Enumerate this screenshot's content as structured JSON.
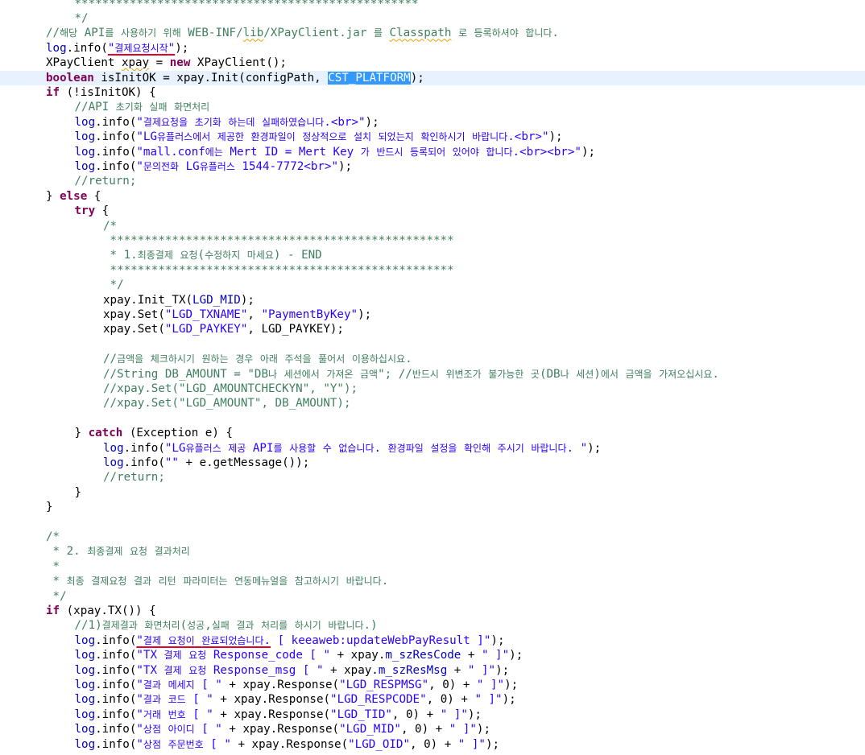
{
  "code_lines": [
    {
      "indent": 1,
      "tokens": [
        {
          "t": "**************************************************",
          "c": "cm"
        }
      ]
    },
    {
      "indent": 1,
      "tokens": [
        {
          "t": "*/",
          "c": "cm"
        }
      ]
    },
    {
      "indent": 0,
      "tokens": [
        {
          "t": "//해당 API를 사용하기 위해 WEB-INF/",
          "c": "cm"
        },
        {
          "t": "lib",
          "c": "cm",
          "sq": true
        },
        {
          "t": "/XPayClient.jar 를 ",
          "c": "cm"
        },
        {
          "t": "Classpath",
          "c": "cm",
          "sq": true
        },
        {
          "t": " 로 등록하셔야 합니다.",
          "c": "cm"
        }
      ]
    },
    {
      "indent": 0,
      "tokens": [
        {
          "t": "log",
          "c": "fld"
        },
        {
          "t": ".info("
        },
        {
          "t": "\"결제요청시작\"",
          "c": "str",
          "ul": true
        },
        {
          "t": ");"
        }
      ]
    },
    {
      "indent": 0,
      "tokens": [
        {
          "t": "XPayClient "
        },
        {
          "t": "xpay",
          "sq": true
        },
        {
          "t": " = "
        },
        {
          "t": "new",
          "c": "kw"
        },
        {
          "t": " XPayClient();"
        }
      ]
    },
    {
      "indent": 0,
      "current": true,
      "tokens": [
        {
          "t": "boolean",
          "c": "kw"
        },
        {
          "t": " isInitOK = xpay.Init(configPath, "
        },
        {
          "t": "CST_PLATFORM",
          "sel": true
        },
        {
          "t": ");"
        }
      ]
    },
    {
      "indent": 0,
      "tokens": [
        {
          "t": "if",
          "c": "kw"
        },
        {
          "t": " (!isInitOK) {"
        }
      ]
    },
    {
      "indent": 1,
      "tokens": [
        {
          "t": "//API 초기화 실패 화면처리",
          "c": "cm"
        }
      ]
    },
    {
      "indent": 1,
      "tokens": [
        {
          "t": "log",
          "c": "fld"
        },
        {
          "t": ".info("
        },
        {
          "t": "\"결제요청을 초기화 하는데 실패하였습니다.<br>\"",
          "c": "str"
        },
        {
          "t": ");"
        }
      ]
    },
    {
      "indent": 1,
      "tokens": [
        {
          "t": "log",
          "c": "fld"
        },
        {
          "t": ".info("
        },
        {
          "t": "\"LG유플러스에서 제공한 환경파일이 정상적으로 설치 되었는지 확인하시기 바랍니다.<br>\"",
          "c": "str"
        },
        {
          "t": ");"
        }
      ]
    },
    {
      "indent": 1,
      "tokens": [
        {
          "t": "log",
          "c": "fld"
        },
        {
          "t": ".info("
        },
        {
          "t": "\"mall.conf에는 Mert ID = Mert Key 가 반드시 등록되어 있어야 합니다.<br><br>\"",
          "c": "str"
        },
        {
          "t": ");"
        }
      ]
    },
    {
      "indent": 1,
      "tokens": [
        {
          "t": "log",
          "c": "fld"
        },
        {
          "t": ".info("
        },
        {
          "t": "\"문의전화 LG유플러스 1544-7772<br>\"",
          "c": "str"
        },
        {
          "t": ");"
        }
      ]
    },
    {
      "indent": 1,
      "tokens": [
        {
          "t": "//return;",
          "c": "cm"
        }
      ]
    },
    {
      "indent": 0,
      "tokens": [
        {
          "t": "} "
        },
        {
          "t": "else",
          "c": "kw"
        },
        {
          "t": " {"
        }
      ]
    },
    {
      "indent": 1,
      "tokens": [
        {
          "t": "try",
          "c": "kw"
        },
        {
          "t": " {"
        }
      ]
    },
    {
      "indent": 2,
      "tokens": [
        {
          "t": "/*",
          "c": "cm"
        }
      ]
    },
    {
      "indent": 2,
      "tokens": [
        {
          "t": " **************************************************",
          "c": "cm"
        }
      ]
    },
    {
      "indent": 2,
      "tokens": [
        {
          "t": " * 1.최종결제 요청(수정하지 마세요) - END",
          "c": "cm"
        }
      ]
    },
    {
      "indent": 2,
      "tokens": [
        {
          "t": " **************************************************",
          "c": "cm"
        }
      ]
    },
    {
      "indent": 2,
      "tokens": [
        {
          "t": " */",
          "c": "cm"
        }
      ]
    },
    {
      "indent": 2,
      "tokens": [
        {
          "t": "xpay.Init_TX("
        },
        {
          "t": "LGD_MID",
          "c": "fld"
        },
        {
          "t": ");"
        }
      ]
    },
    {
      "indent": 2,
      "tokens": [
        {
          "t": "xpay.Set("
        },
        {
          "t": "\"LGD_TXNAME\"",
          "c": "str"
        },
        {
          "t": ", "
        },
        {
          "t": "\"PaymentByKey\"",
          "c": "str"
        },
        {
          "t": ");"
        }
      ]
    },
    {
      "indent": 2,
      "tokens": [
        {
          "t": "xpay.Set("
        },
        {
          "t": "\"LGD_PAYKEY\"",
          "c": "str"
        },
        {
          "t": ", LGD_PAYKEY);"
        }
      ]
    },
    {
      "indent": 0,
      "tokens": []
    },
    {
      "indent": 2,
      "tokens": [
        {
          "t": "//금액을 체크하시기 원하는 경우 아래 주석을 풀어서 이용하십시요.",
          "c": "cm"
        }
      ]
    },
    {
      "indent": 2,
      "tokens": [
        {
          "t": "//String DB_AMOUNT = \"DB나 세션에서 가져온 금액\"; //반드시 위변조가 불가능한 곳(DB나 세션)에서 금액을 가져오십시요.",
          "c": "cm"
        }
      ]
    },
    {
      "indent": 2,
      "tokens": [
        {
          "t": "//xpay.Set(\"LGD_AMOUNTCHECKYN\", \"Y\");",
          "c": "cm"
        }
      ]
    },
    {
      "indent": 2,
      "tokens": [
        {
          "t": "//xpay.Set(\"LGD_AMOUNT\", DB_AMOUNT);",
          "c": "cm"
        }
      ]
    },
    {
      "indent": 0,
      "tokens": []
    },
    {
      "indent": 1,
      "tokens": [
        {
          "t": "} "
        },
        {
          "t": "catch",
          "c": "kw"
        },
        {
          "t": " (Exception e) {"
        }
      ]
    },
    {
      "indent": 2,
      "tokens": [
        {
          "t": "log",
          "c": "fld"
        },
        {
          "t": ".info("
        },
        {
          "t": "\"LG유플러스 제공 API를 사용할 수 없습니다. 환경파일 설정을 확인해 주시기 바랍니다. \"",
          "c": "str"
        },
        {
          "t": ");"
        }
      ]
    },
    {
      "indent": 2,
      "tokens": [
        {
          "t": "log",
          "c": "fld"
        },
        {
          "t": ".info("
        },
        {
          "t": "\"\"",
          "c": "str"
        },
        {
          "t": " + e.getMessage());"
        }
      ]
    },
    {
      "indent": 2,
      "tokens": [
        {
          "t": "//return;",
          "c": "cm"
        }
      ]
    },
    {
      "indent": 1,
      "tokens": [
        {
          "t": "}"
        }
      ]
    },
    {
      "indent": 0,
      "tokens": [
        {
          "t": "}"
        }
      ]
    },
    {
      "indent": 0,
      "tokens": []
    },
    {
      "indent": 0,
      "tokens": [
        {
          "t": "/*",
          "c": "cm"
        }
      ]
    },
    {
      "indent": 0,
      "tokens": [
        {
          "t": " * 2. 최종결제 요청 결과처리",
          "c": "cm"
        }
      ]
    },
    {
      "indent": 0,
      "tokens": [
        {
          "t": " *",
          "c": "cm"
        }
      ]
    },
    {
      "indent": 0,
      "tokens": [
        {
          "t": " * 최종 결제요청 결과 리턴 파라미터는 연동메뉴얼을 참고하시기 바랍니다.",
          "c": "cm"
        }
      ]
    },
    {
      "indent": 0,
      "tokens": [
        {
          "t": " */",
          "c": "cm"
        }
      ]
    },
    {
      "indent": 0,
      "tokens": [
        {
          "t": "if",
          "c": "kw"
        },
        {
          "t": " (xpay.TX()) {"
        }
      ]
    },
    {
      "indent": 1,
      "tokens": [
        {
          "t": "//1)결제결과 화면처리(성공,실패 결과 처리를 하시기 바랍니다.)",
          "c": "cm"
        }
      ]
    },
    {
      "indent": 1,
      "tokens": [
        {
          "t": "log",
          "c": "fld"
        },
        {
          "t": ".info("
        },
        {
          "t": "\"결제 요청이 완료되었습니다.",
          "c": "str",
          "ul": true
        },
        {
          "t": " [ keeaweb:updateWebPayResult ]\"",
          "c": "str"
        },
        {
          "t": ");"
        }
      ]
    },
    {
      "indent": 1,
      "tokens": [
        {
          "t": "log",
          "c": "fld"
        },
        {
          "t": ".info("
        },
        {
          "t": "\"TX 결제 요청 Response_code [ \"",
          "c": "str"
        },
        {
          "t": " + xpay."
        },
        {
          "t": "m_szResCode",
          "c": "fld"
        },
        {
          "t": " + "
        },
        {
          "t": "\" ]\"",
          "c": "str"
        },
        {
          "t": ");"
        }
      ]
    },
    {
      "indent": 1,
      "tokens": [
        {
          "t": "log",
          "c": "fld"
        },
        {
          "t": ".info("
        },
        {
          "t": "\"TX 결제 요청 Response_msg [ \"",
          "c": "str"
        },
        {
          "t": " + xpay."
        },
        {
          "t": "m_szResMsg",
          "c": "fld"
        },
        {
          "t": " + "
        },
        {
          "t": "\" ]\"",
          "c": "str"
        },
        {
          "t": ");"
        }
      ]
    },
    {
      "indent": 1,
      "tokens": [
        {
          "t": "log",
          "c": "fld"
        },
        {
          "t": ".info("
        },
        {
          "t": "\"결과 메세지 [ \"",
          "c": "str"
        },
        {
          "t": " + xpay.Response("
        },
        {
          "t": "\"LGD_RESPMSG\"",
          "c": "str"
        },
        {
          "t": ", 0) + "
        },
        {
          "t": "\" ]\"",
          "c": "str"
        },
        {
          "t": ");"
        }
      ]
    },
    {
      "indent": 1,
      "tokens": [
        {
          "t": "log",
          "c": "fld"
        },
        {
          "t": ".info("
        },
        {
          "t": "\"결과 코드 [ \"",
          "c": "str"
        },
        {
          "t": " + xpay.Response("
        },
        {
          "t": "\"LGD_RESPCODE\"",
          "c": "str"
        },
        {
          "t": ", 0) + "
        },
        {
          "t": "\" ]\"",
          "c": "str"
        },
        {
          "t": ");"
        }
      ]
    },
    {
      "indent": 1,
      "tokens": [
        {
          "t": "log",
          "c": "fld"
        },
        {
          "t": ".info("
        },
        {
          "t": "\"거래 번호 [ \"",
          "c": "str"
        },
        {
          "t": " + xpay.Response("
        },
        {
          "t": "\"LGD_TID\"",
          "c": "str"
        },
        {
          "t": ", 0) + "
        },
        {
          "t": "\" ]\"",
          "c": "str"
        },
        {
          "t": ");"
        }
      ]
    },
    {
      "indent": 1,
      "tokens": [
        {
          "t": "log",
          "c": "fld"
        },
        {
          "t": ".info("
        },
        {
          "t": "\"상점 아이디 [ \"",
          "c": "str"
        },
        {
          "t": " + xpay.Response("
        },
        {
          "t": "\"LGD_MID\"",
          "c": "str"
        },
        {
          "t": ", 0) + "
        },
        {
          "t": "\" ]\"",
          "c": "str"
        },
        {
          "t": ");"
        }
      ]
    },
    {
      "indent": 1,
      "tokens": [
        {
          "t": "log",
          "c": "fld"
        },
        {
          "t": ".info("
        },
        {
          "t": "\"상점 주문번호 [ \"",
          "c": "str"
        },
        {
          "t": " + xpay.Response("
        },
        {
          "t": "\"LGD_OID\"",
          "c": "str"
        },
        {
          "t": ", 0) + "
        },
        {
          "t": "\" ]\"",
          "c": "str"
        },
        {
          "t": ");"
        }
      ]
    }
  ]
}
